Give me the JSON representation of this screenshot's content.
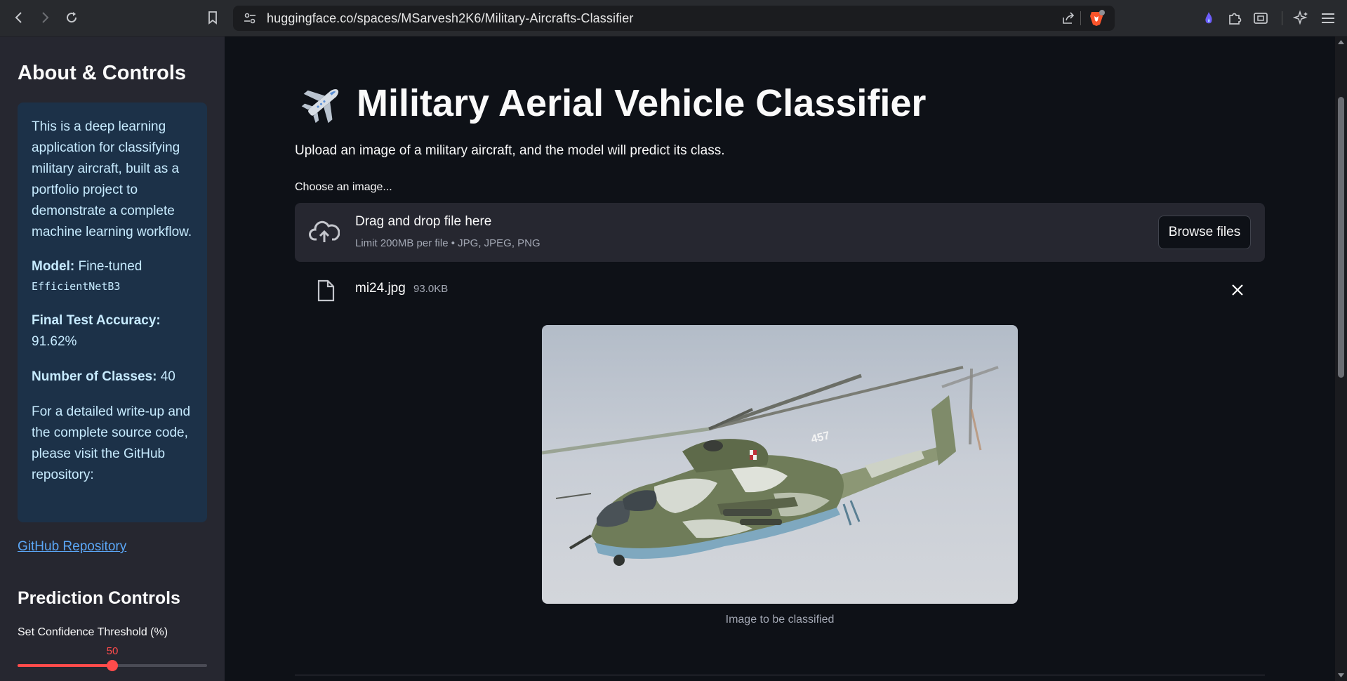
{
  "browser": {
    "url": "huggingface.co/spaces/MSarvesh2K6/Military-Aircrafts-Classifier"
  },
  "sidebar": {
    "title": "About & Controls",
    "info": {
      "intro": "This is a deep learning application for classifying military aircraft, built as a portfolio project to demonstrate a complete machine learning workflow.",
      "model_label": "Model:",
      "model_value": "Fine-tuned",
      "model_code": "EfficientNetB3",
      "accuracy_label": "Final Test Accuracy:",
      "accuracy_value": "91.62%",
      "classes_label": "Number of Classes:",
      "classes_value": "40",
      "writeup": "For a detailed write-up and the complete source code, please visit the GitHub repository:"
    },
    "github_link": "GitHub Repository",
    "prediction_controls_title": "Prediction Controls",
    "threshold_label": "Set Confidence Threshold (%)",
    "threshold_value": "50",
    "threshold_fraction": 0.5
  },
  "main": {
    "title": "Military Aerial Vehicle Classifier",
    "subtitle": "Upload an image of a military aircraft, and the model will predict its class.",
    "uploader_label": "Choose an image...",
    "dropzone_main": "Drag and drop file here",
    "dropzone_sub": "Limit 200MB per file • JPG, JPEG, PNG",
    "browse_button": "Browse files",
    "file_name": "mi24.jpg",
    "file_size": "93.0KB",
    "image_caption": "Image to be classified",
    "image_markings": "457"
  },
  "colors": {
    "accent": "#ff4b4b",
    "info_bg": "#1c3148",
    "info_text": "#c7ebff",
    "link": "#5ba7f7",
    "background": "#0e1117",
    "sidebar_bg": "#262730"
  }
}
